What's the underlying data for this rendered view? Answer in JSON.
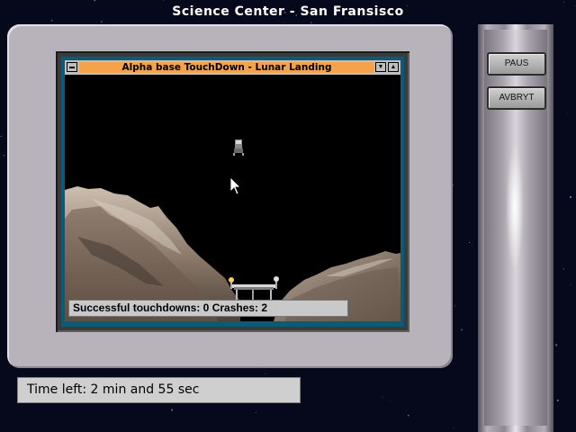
{
  "window_title": "Science Center - San Fransisco",
  "game_window": {
    "title": "Alpha base TouchDown - Lunar Landing",
    "status": "Successful touchdowns: 0  Crashes: 2"
  },
  "buttons": {
    "pause": "PAUS",
    "cancel": "AVBRYT"
  },
  "time_left": "Time left: 2 min and 55 sec",
  "colors": {
    "title_bar": "#f5a24a",
    "screen_border": "#0c5a78",
    "monitor_bezel": "#b8b2bb"
  }
}
